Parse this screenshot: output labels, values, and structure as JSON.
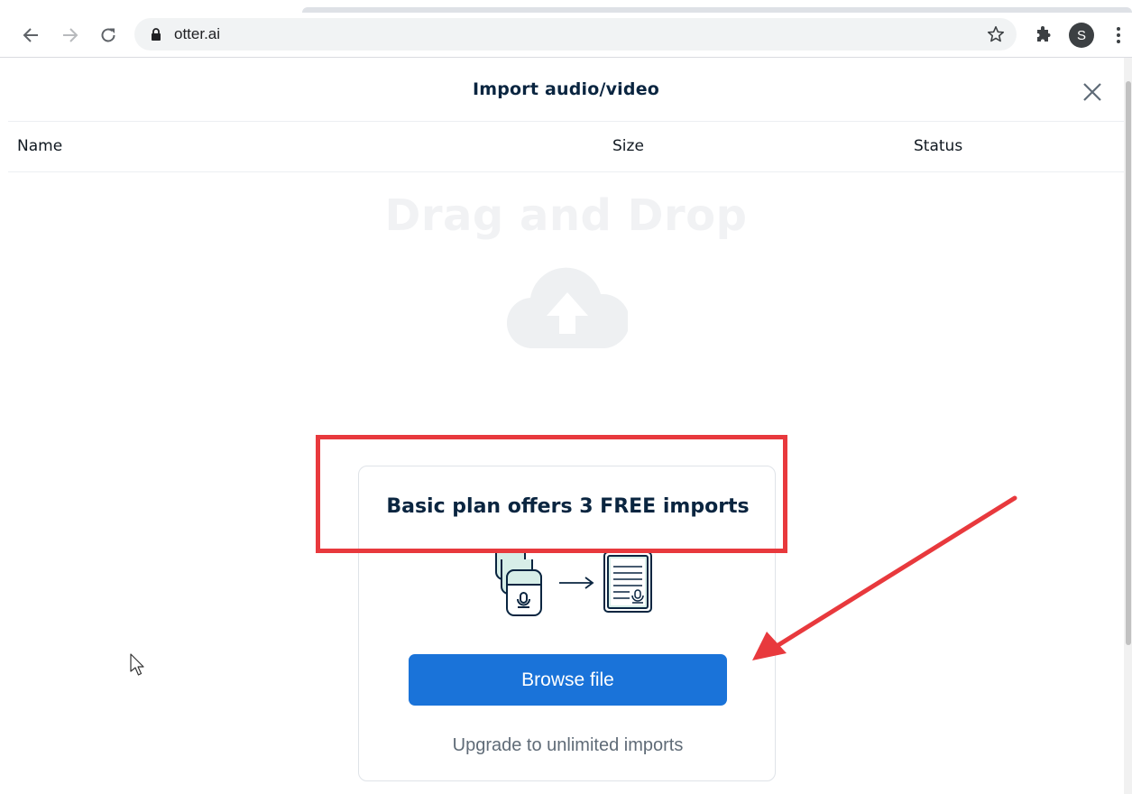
{
  "browser": {
    "url": "otter.ai",
    "avatar_letter": "S"
  },
  "modal": {
    "title": "Import audio/video",
    "columns": [
      "Name",
      "Size",
      "Status"
    ],
    "dropzone_title": "Drag and Drop"
  },
  "card": {
    "title": "Basic plan offers 3 FREE imports",
    "browse_label": "Browse file",
    "upgrade_label": "Upgrade to unlimited imports"
  },
  "colors": {
    "accent": "#1a73d9",
    "annotation": "#e8393d",
    "title_text": "#0a2540"
  },
  "icons": [
    "back-arrow-icon",
    "forward-arrow-icon",
    "reload-icon",
    "lock-icon",
    "star-icon",
    "extensions-icon",
    "kebab-menu-icon",
    "close-icon",
    "cloud-upload-icon",
    "audio-to-transcript-icon",
    "mouse-cursor-icon"
  ]
}
